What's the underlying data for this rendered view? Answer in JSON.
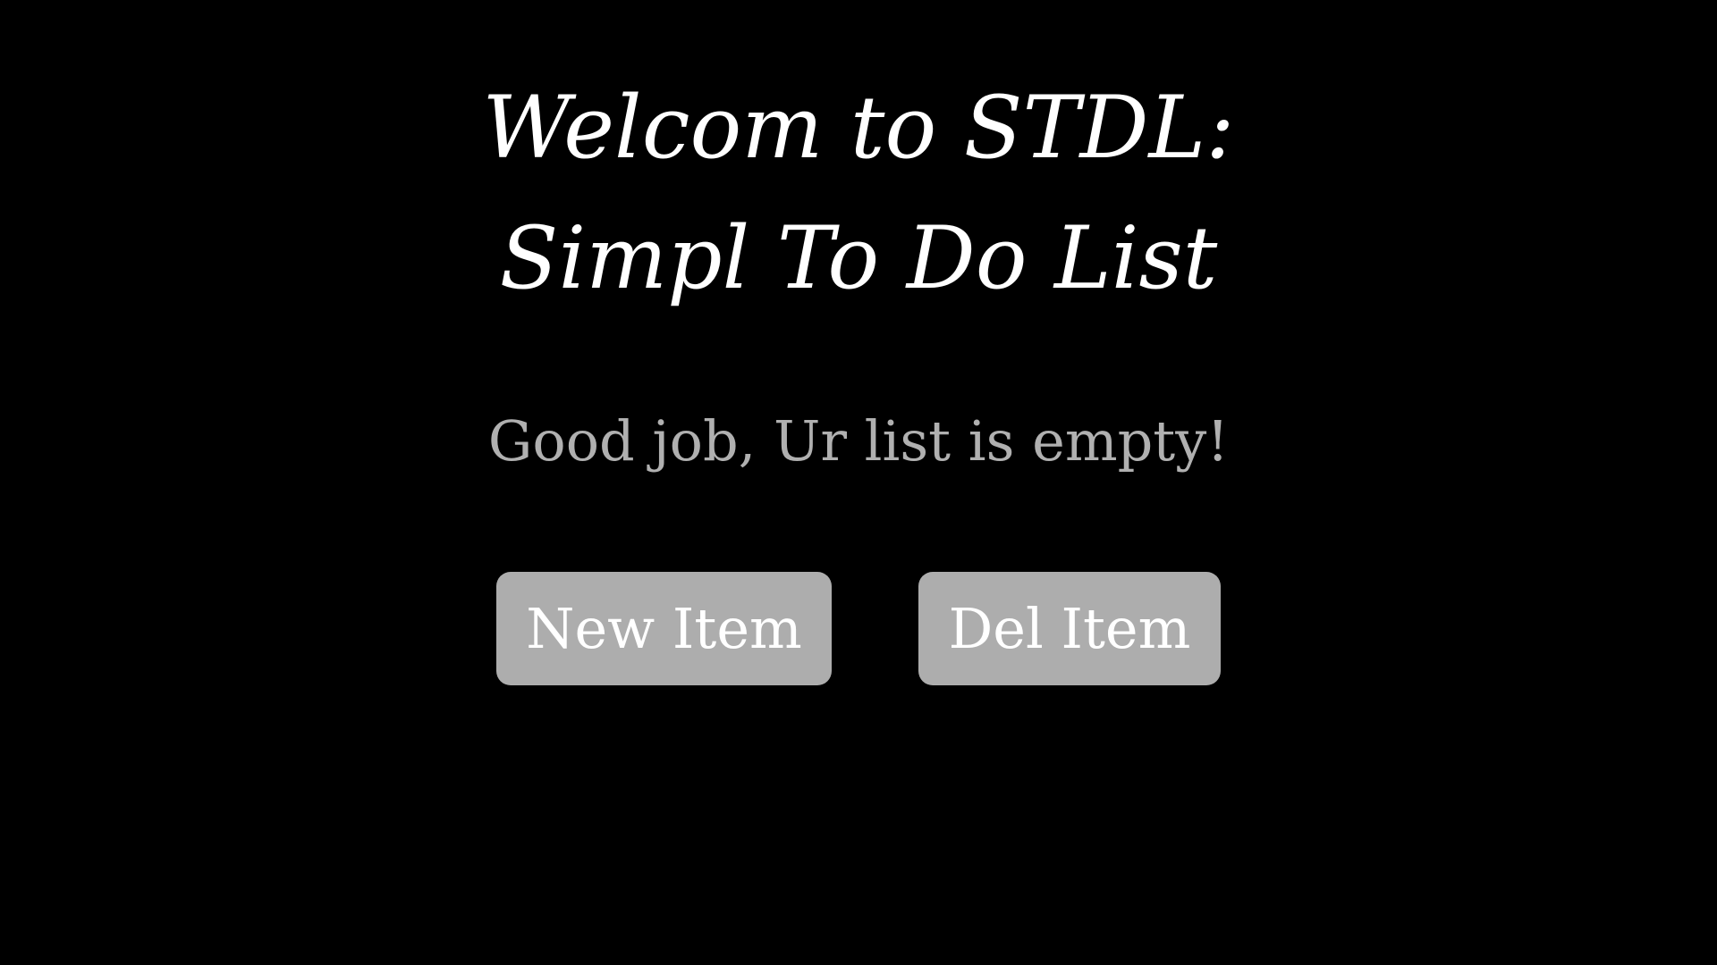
{
  "header": {
    "title_line1": "Welcom to STDL:",
    "title_line2": "Simpl To Do List"
  },
  "main": {
    "status_text": "Good job, Ur list is empty!"
  },
  "actions": {
    "new_item_label": "New Item",
    "del_item_label": "Del Item"
  },
  "colors": {
    "background": "#000000",
    "title_text": "#ffffff",
    "status_text": "#b0b0b0",
    "button_background": "#adadad",
    "button_text": "#ffffff"
  }
}
